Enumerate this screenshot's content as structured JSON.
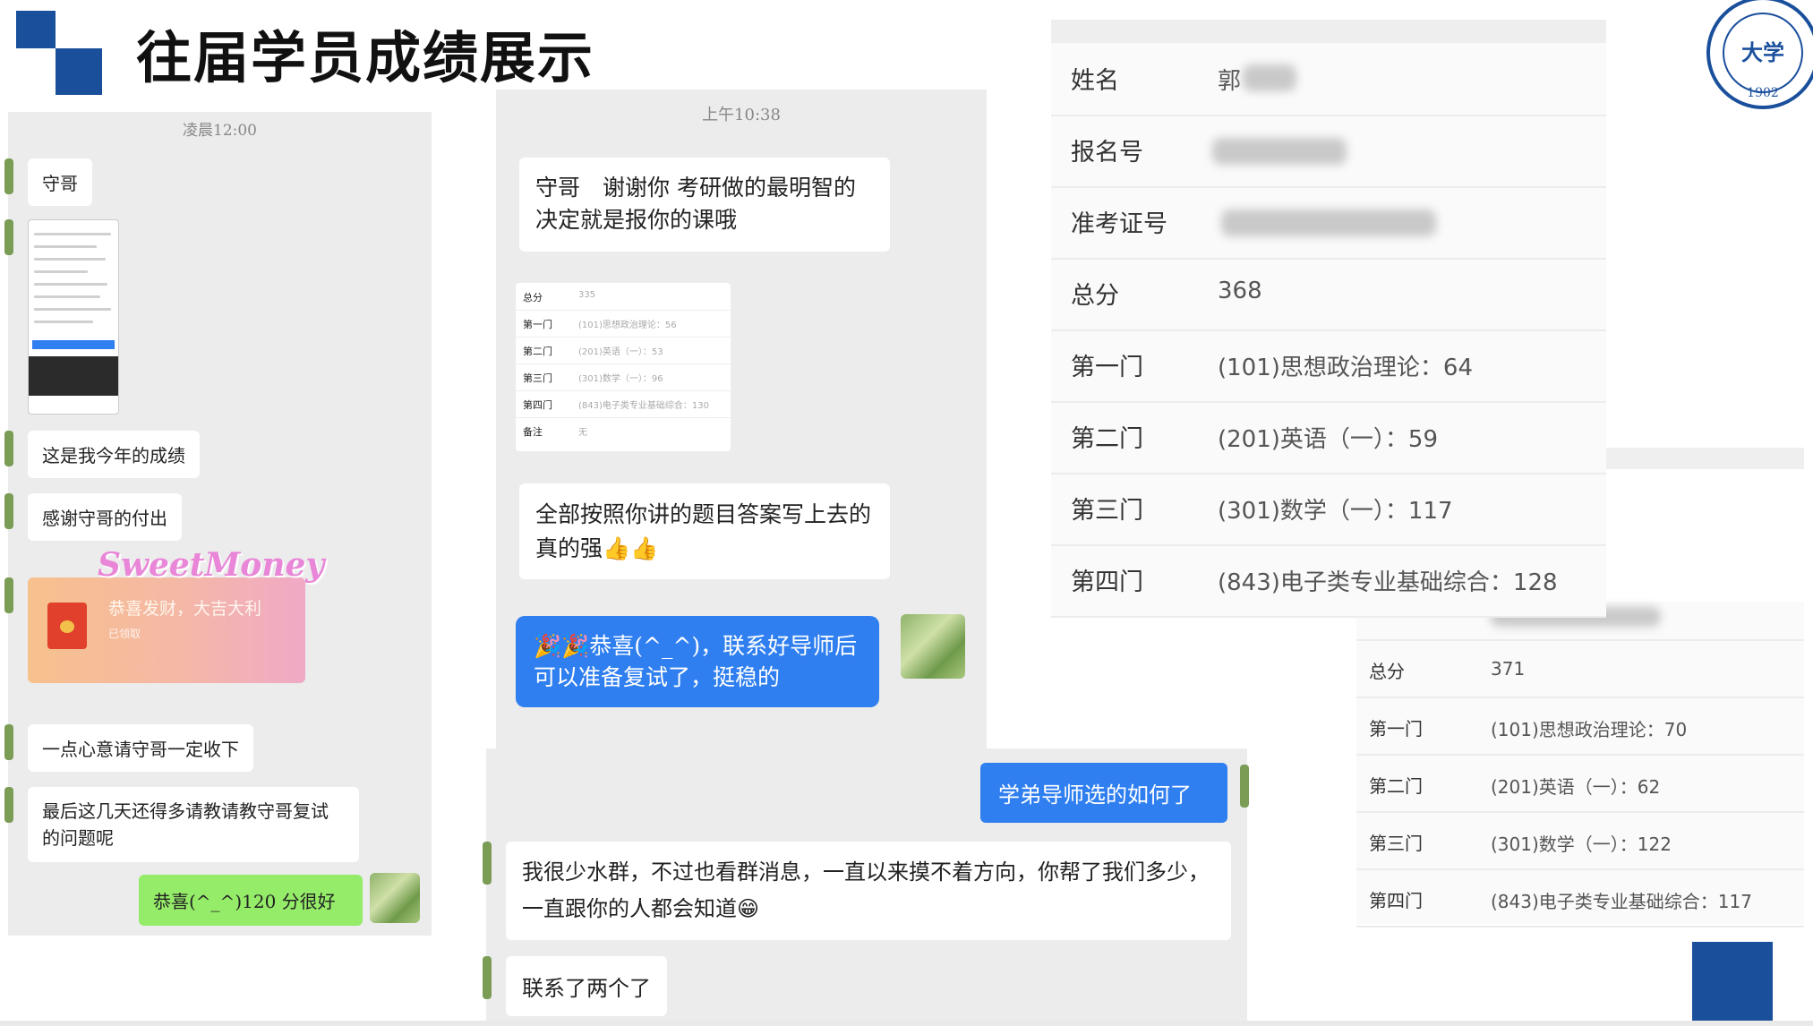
{
  "header": {
    "title": "往届学员成绩展示",
    "logo": {
      "text": "大学",
      "year": "1902"
    },
    "accent": "#1a4f9c"
  },
  "chat1": {
    "timestamp": "凌晨12:00",
    "messages": [
      "守哥",
      "这是我今年的成绩",
      "感谢守哥的付出",
      "一点心意请守哥一定收下",
      "最后这几天还得多请教请教守哥复试的问题呢"
    ],
    "red_packet": {
      "text": "恭喜发财，大吉大利",
      "amount": "已领取",
      "sticker": "SweetMoney"
    },
    "reply": "恭喜(^_^)120 分很好"
  },
  "chat2": {
    "timestamp": "上午10:38",
    "msg1": "守哥　谢谢你 考研做的最明智的决定就是报你的课哦",
    "msg2": "全部按照你讲的题目答案写上去的 真的强👍👍",
    "reply": "🎉🎉恭喜(^_^)，联系好导师后可以准备复试了，挺稳的",
    "score_thumb": [
      {
        "k": "总分",
        "v": "335"
      },
      {
        "k": "第一门",
        "v": "(101)思想政治理论：56"
      },
      {
        "k": "第二门",
        "v": "(201)英语（一）：53"
      },
      {
        "k": "第三门",
        "v": "(301)数学（一）：96"
      },
      {
        "k": "第四门",
        "v": "(843)电子类专业基础综合：130"
      },
      {
        "k": "备注",
        "v": "无"
      }
    ]
  },
  "chat3": {
    "reply": "学弟导师选的如何了",
    "msg1": "我很少水群，不过也看群消息，一直以来摸不着方向，你帮了我们多少，一直跟你的人都会知道😁",
    "msg2": "联系了两个了"
  },
  "score1": {
    "name_label": "姓名",
    "name_value": "郭",
    "rows": [
      {
        "k": "报名号",
        "v": ""
      },
      {
        "k": "准考证号",
        "v": ""
      },
      {
        "k": "总分",
        "v": "368"
      },
      {
        "k": "第一门",
        "v": "(101)思想政治理论：64"
      },
      {
        "k": "第二门",
        "v": "(201)英语（一）：59"
      },
      {
        "k": "第三门",
        "v": "(301)数学（一）：117"
      },
      {
        "k": "第四门",
        "v": "(843)电子类专业基础综合：128"
      }
    ]
  },
  "score2": {
    "rows": [
      {
        "k": "总分",
        "v": "371"
      },
      {
        "k": "第一门",
        "v": "(101)思想政治理论：70"
      },
      {
        "k": "第二门",
        "v": "(201)英语（一）：62"
      },
      {
        "k": "第三门",
        "v": "(301)数学（一）：122"
      },
      {
        "k": "第四门",
        "v": "(843)电子类专业基础综合：117"
      }
    ]
  }
}
